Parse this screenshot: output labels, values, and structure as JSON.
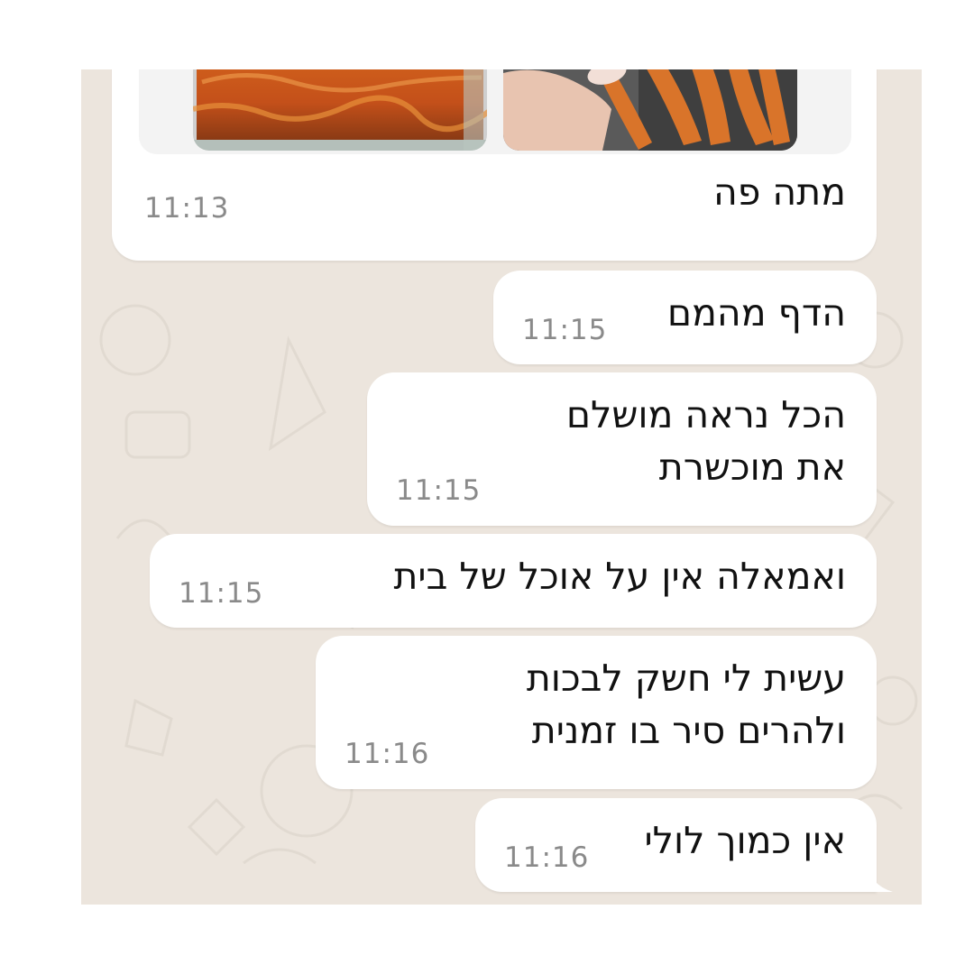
{
  "chat": {
    "messages": [
      {
        "id": "m1",
        "text_lines": [
          "מתה פה"
        ],
        "time": "11:13",
        "has_images": true
      },
      {
        "id": "m2",
        "text_lines": [
          "הדף מהמם"
        ],
        "time": "11:15"
      },
      {
        "id": "m3",
        "text_lines": [
          "הכל נראה מושלם",
          "את מוכשרת"
        ],
        "time": "11:15"
      },
      {
        "id": "m4",
        "text_lines": [
          "ואמאלה אין על אוכל של בית"
        ],
        "time": "11:15"
      },
      {
        "id": "m5",
        "text_lines": [
          "עשית לי חשק לבכות",
          "ולהרים סיר בו זמנית"
        ],
        "time": "11:16"
      },
      {
        "id": "m6",
        "text_lines": [
          "אין כמוך לולי"
        ],
        "time": "11:16"
      }
    ],
    "images": [
      {
        "id": "img-left",
        "subject": "baked casserole in glass dish"
      },
      {
        "id": "img-right",
        "subject": "hand holding roasted sweet potato strips"
      }
    ]
  },
  "colors": {
    "chat_background": "#ECE5DD",
    "bubble": "#FFFFFF",
    "time_text": "#8A8A8A",
    "message_text": "#111111"
  }
}
